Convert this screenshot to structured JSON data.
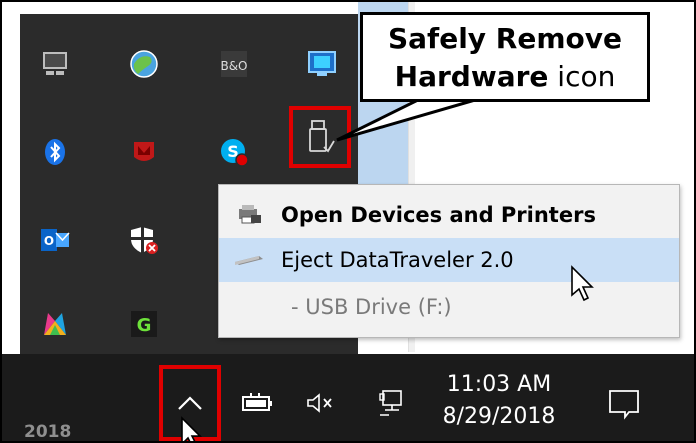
{
  "callout": {
    "line1": "Safely Remove",
    "line2_bold": "Hardware",
    "line2_rest": " icon"
  },
  "popup_menu": {
    "open_devices": "Open Devices and Printers",
    "eject": "Eject DataTraveler 2.0",
    "usb_drive": "- USB Drive (F:)"
  },
  "tray_icons": [
    "monitor-icon",
    "globe-icon",
    "bo-icon",
    "intel-graphics-icon",
    "bluetooth-icon",
    "mcafee-icon",
    "skype-icon",
    "safely-remove-hardware-icon",
    "outlook-icon",
    "defender-icon",
    "color-app-icon",
    "green-g-icon"
  ],
  "tray_icon_labels": {
    "bo": "B&O",
    "outlook": "O"
  },
  "taskbar": {
    "year_fragment": "2018",
    "time": "11:03 AM",
    "date": "8/29/2018"
  },
  "colors": {
    "highlight_red": "#e00000",
    "tray_bg": "#2b2b2b",
    "taskbar_bg": "#1b1b1b",
    "menu_selected": "#c9dff6"
  }
}
